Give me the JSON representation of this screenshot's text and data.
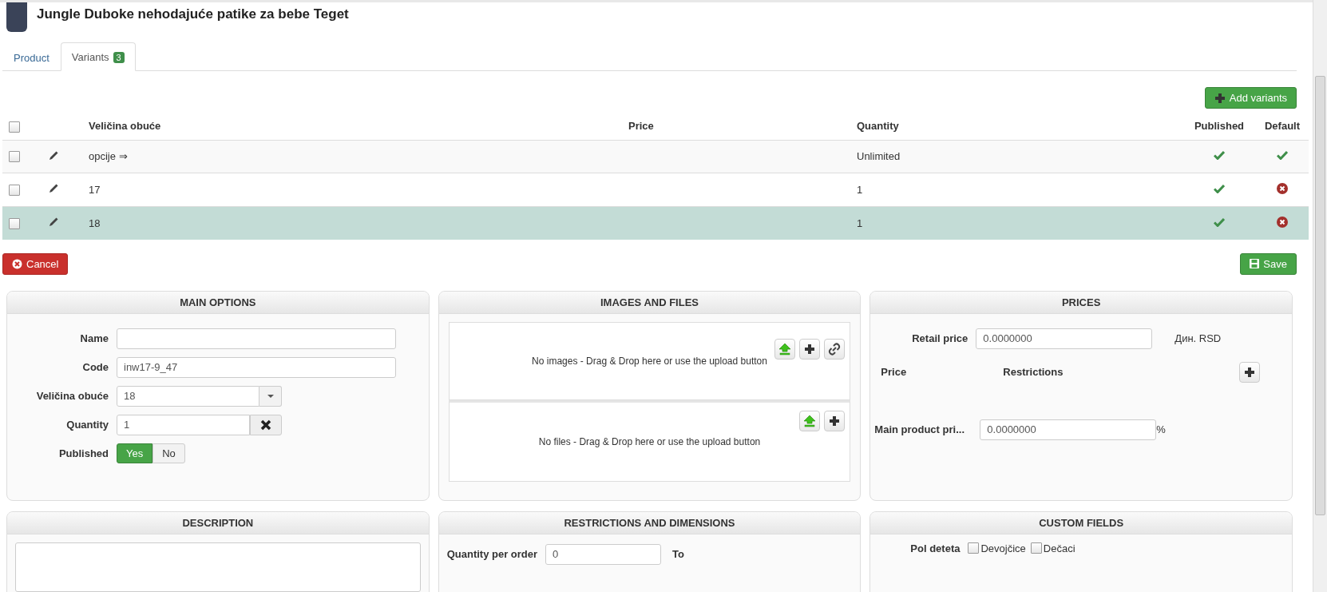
{
  "header": {
    "title": "Jungle Duboke nehodajuće patike za bebe Teget"
  },
  "tabs": [
    {
      "label": "Product",
      "selected": false
    },
    {
      "label": "Variants",
      "badge": "3",
      "selected": true
    }
  ],
  "add_variants_button": "Add variants",
  "table": {
    "all_checked": false,
    "columns": [
      "Veličina obuće",
      "Price",
      "Quantity",
      "Published",
      "Default"
    ],
    "rows": [
      {
        "checked": false,
        "size": "opcije ⇒",
        "quantity": "Unlimited",
        "published": true,
        "default": true,
        "selected": false
      },
      {
        "checked": false,
        "size": "17",
        "quantity": "1",
        "published": true,
        "default": false,
        "selected": false
      },
      {
        "checked": false,
        "size": "18",
        "quantity": "1",
        "published": true,
        "default": false,
        "selected": true
      }
    ]
  },
  "cancel_button": "Cancel",
  "save_button": "Save",
  "main_options": {
    "title": "MAIN OPTIONS",
    "fields": [
      {
        "kind": "text",
        "label": "Name"
      },
      {
        "kind": "text",
        "label": "Code",
        "value": "inw17-9_47"
      },
      {
        "kind": "select",
        "label": "Veličina obuće",
        "value": "18"
      },
      {
        "kind": "clearable",
        "label": "Quantity",
        "value": "1"
      },
      {
        "kind": "toggle",
        "label": "Published",
        "options": [
          {
            "label": "Yes",
            "selected": true
          },
          {
            "label": "No",
            "selected": false
          }
        ]
      }
    ]
  },
  "images_and_files": {
    "title": "IMAGES AND FILES",
    "zones": [
      {
        "text": "No images - Drag & Drop here or use the upload button",
        "buttons": [
          {
            "kind": "upload"
          },
          {
            "kind": "add"
          },
          {
            "kind": "link"
          }
        ]
      },
      {
        "text": "No files - Drag & Drop here or use the upload button",
        "buttons": [
          {
            "kind": "upload"
          },
          {
            "kind": "add"
          }
        ]
      }
    ]
  },
  "prices": {
    "title": "PRICES",
    "retail_price": {
      "label": "Retail price",
      "value": "0.0000000",
      "currency": "Дин. RSD"
    },
    "columns": [
      "Price",
      "Restrictions"
    ],
    "main_product_price": {
      "label": "Main product pri...",
      "value": "0.0000000",
      "unit": "%"
    }
  },
  "description": {
    "title": "DESCRIPTION"
  },
  "restrictions": {
    "title": "RESTRICTIONS AND DIMENSIONS",
    "quantity_per_order": {
      "label": "Quantity per order",
      "value": "0",
      "to_label": "To"
    }
  },
  "custom_fields": {
    "title": "CUSTOM FIELDS",
    "fields": [
      {
        "label": "Pol deteta",
        "options": [
          {
            "label": "Devojčice",
            "checked": false
          },
          {
            "label": "Dečaci",
            "checked": false
          }
        ]
      }
    ]
  }
}
